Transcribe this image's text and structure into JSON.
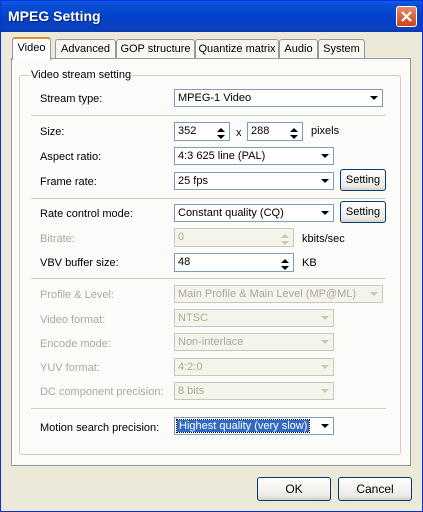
{
  "window": {
    "title": "MPEG Setting"
  },
  "tabs": [
    "Video",
    "Advanced",
    "GOP structure",
    "Quantize matrix",
    "Audio",
    "System"
  ],
  "group": {
    "label": "Video stream setting"
  },
  "stream_type": {
    "label": "Stream type:",
    "value": "MPEG-1 Video"
  },
  "size": {
    "label": "Size:",
    "width": "352",
    "x": "x",
    "height": "288",
    "unit": "pixels"
  },
  "aspect_ratio": {
    "label": "Aspect ratio:",
    "value": "4:3 625 line (PAL)"
  },
  "frame_rate": {
    "label": "Frame rate:",
    "value": "25 fps",
    "setting": "Setting"
  },
  "rate_control": {
    "label": "Rate control mode:",
    "value": "Constant quality (CQ)",
    "setting": "Setting"
  },
  "bitrate": {
    "label": "Bitrate:",
    "value": "0",
    "unit": "kbits/sec"
  },
  "vbv": {
    "label": "VBV buffer size:",
    "value": "48",
    "unit": "KB"
  },
  "profile_level": {
    "label": "Profile & Level:",
    "value": "Main Profile & Main Level (MP@ML)"
  },
  "video_format": {
    "label": "Video format:",
    "value": "NTSC"
  },
  "encode_mode": {
    "label": "Encode mode:",
    "value": "Non-interlace"
  },
  "yuv_format": {
    "label": "YUV format:",
    "value": "4:2:0"
  },
  "dc_precision": {
    "label": "DC component precision:",
    "value": "8 bits"
  },
  "motion_search": {
    "label": "Motion search precision:",
    "value": "Highest quality (very slow)"
  },
  "buttons": {
    "ok": "OK",
    "cancel": "Cancel"
  }
}
